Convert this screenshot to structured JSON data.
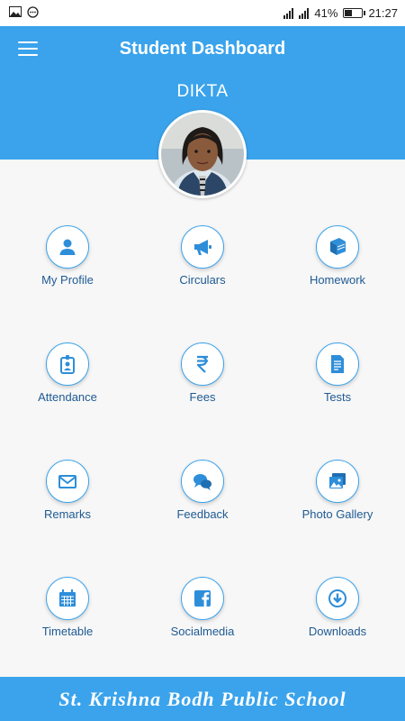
{
  "status_bar": {
    "battery": "41%",
    "time": "21:27",
    "icons": [
      "image-icon",
      "messenger-icon",
      "signal-icon",
      "signal-icon",
      "battery-icon"
    ]
  },
  "header": {
    "title": "Student Dashboard",
    "student_name": "DIKTA",
    "menu_icon": "hamburger-menu-icon"
  },
  "tiles": [
    {
      "label": "My Profile",
      "icon": "person-icon"
    },
    {
      "label": "Circulars",
      "icon": "megaphone-icon"
    },
    {
      "label": "Homework",
      "icon": "book-icon"
    },
    {
      "label": "Attendance",
      "icon": "id-badge-icon"
    },
    {
      "label": "Fees",
      "icon": "rupee-icon"
    },
    {
      "label": "Tests",
      "icon": "document-icon"
    },
    {
      "label": "Remarks",
      "icon": "envelope-icon"
    },
    {
      "label": "Feedback",
      "icon": "chat-bubbles-icon"
    },
    {
      "label": "Photo Gallery",
      "icon": "photos-icon"
    },
    {
      "label": "Timetable",
      "icon": "calendar-icon"
    },
    {
      "label": "Socialmedia",
      "icon": "facebook-icon"
    },
    {
      "label": "Downloads",
      "icon": "download-icon"
    }
  ],
  "footer": {
    "school_name": "St. Krishna Bodh Public School"
  },
  "colors": {
    "primary": "#3aa3ec",
    "label": "#1e5a93",
    "background": "#f7f7f7"
  }
}
